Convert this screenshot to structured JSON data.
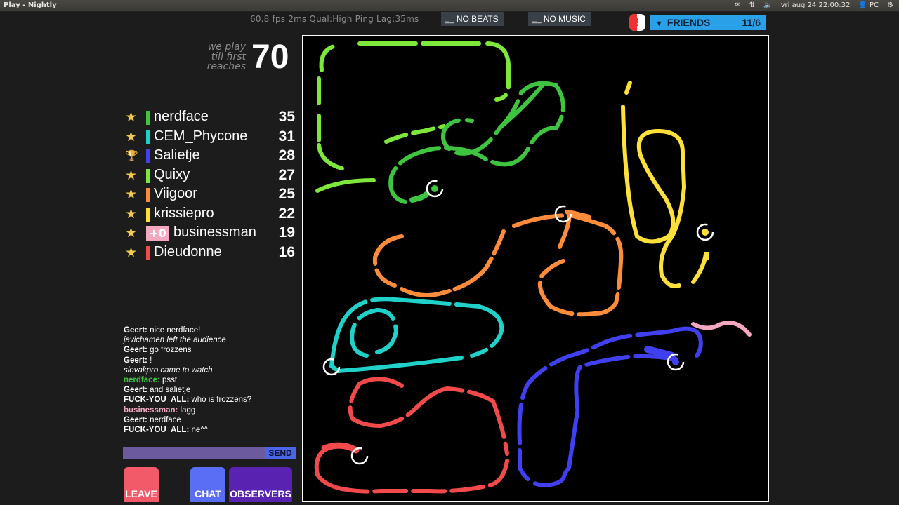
{
  "window": {
    "title": "Play - Nightly"
  },
  "tray": {
    "datetime": "vri aug 24 22:00:32",
    "user": "PC"
  },
  "perf_text": "60.8 fps 2ms Qual:High Ping Lag:35ms",
  "buttons": {
    "no_beats": "NO BEATS",
    "no_music": "NO MUSIC",
    "alert": "!"
  },
  "friends": {
    "label": "FRIENDS",
    "count": "11/6"
  },
  "goal": {
    "line1": "we play",
    "line2": "till first",
    "line3": "reaches",
    "target": "70"
  },
  "players": [
    {
      "name": "nerdface",
      "score": "35",
      "color": "#3ec43e",
      "icon": "star-icon"
    },
    {
      "name": "CEM_Phycone",
      "score": "31",
      "color": "#1fd1c8",
      "icon": "star-icon"
    },
    {
      "name": "Salietje",
      "score": "28",
      "color": "#4040f0",
      "icon": "trophy-icon"
    },
    {
      "name": "Quixy",
      "score": "27",
      "color": "#7ee83a",
      "icon": "star-icon"
    },
    {
      "name": "Viigoor",
      "score": "25",
      "color": "#ff8c3a",
      "icon": "star-icon"
    },
    {
      "name": "krissiepro",
      "score": "22",
      "color": "#ffe03a",
      "icon": "star-icon"
    },
    {
      "name": "businessman",
      "score": "19",
      "color": "#f4a8bf",
      "icon": "star-icon",
      "badge": "+0"
    },
    {
      "name": "Dieudonne",
      "score": "16",
      "color": "#f24a4a",
      "icon": "star-icon"
    }
  ],
  "chat": [
    {
      "user": "Geert:",
      "text": " nice nerdface!",
      "type": "msg"
    },
    {
      "text": "javichamen left the audience",
      "type": "sys"
    },
    {
      "user": "Geert:",
      "text": " go frozzens",
      "type": "msg"
    },
    {
      "user": "Geert:",
      "text": " !",
      "type": "msg"
    },
    {
      "text": "slovakpro came to watch",
      "type": "sys"
    },
    {
      "user": "nerdface:",
      "text": " psst",
      "type": "msg",
      "color": "#3ec43e"
    },
    {
      "user": "Geert:",
      "text": " and salietje",
      "type": "msg"
    },
    {
      "user": "FUCK-YOU_ALL:",
      "text": " who is frozzens?",
      "type": "msg"
    },
    {
      "user": "businessman:",
      "text": " lagg",
      "type": "msg",
      "color": "#f4a8bf"
    },
    {
      "user": "Geert:",
      "text": " nerdface",
      "type": "msg"
    },
    {
      "user": "FUCK-YOU_ALL:",
      "text": " ne^^",
      "type": "msg"
    }
  ],
  "chat_input": {
    "value": "",
    "send_label": "SEND"
  },
  "bottom_buttons": {
    "leave": "LEAVE",
    "chat": "CHAT",
    "observers": "OBSERVERS"
  }
}
